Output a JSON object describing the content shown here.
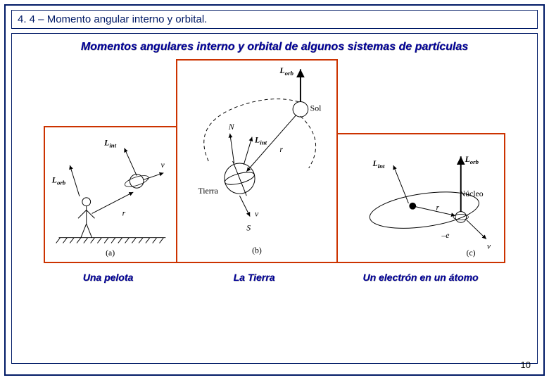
{
  "header": {
    "title": "4. 4 – Momento angular interno y orbital."
  },
  "main": {
    "subtitle": "Momentos angulares interno y orbital de algunos sistemas de partículas",
    "figures": {
      "a": {
        "caption": "Una pelota",
        "subcaption": "(a)",
        "labels": {
          "L_int": "L",
          "L_int_sub": "int",
          "L_orb": "L",
          "L_orb_sub": "orb",
          "v": "v",
          "r": "r"
        }
      },
      "b": {
        "caption": "La Tierra",
        "subcaption": "(b)",
        "labels": {
          "L_orb": "L",
          "L_orb_sub": "orb",
          "L_int": "L",
          "L_int_sub": "int",
          "N": "N",
          "S": "S",
          "Sol": "Sol",
          "Tierra": "Tierra",
          "r": "r",
          "v": "v"
        }
      },
      "c": {
        "caption": "Un electrón en un átomo",
        "subcaption": "(c)",
        "labels": {
          "L_int": "L",
          "L_int_sub": "int",
          "L_orb": "L",
          "L_orb_sub": "orb",
          "Nucleo": "Núcleo",
          "r": "r",
          "e": "–e",
          "v": "v"
        }
      }
    }
  },
  "page_number": "10"
}
